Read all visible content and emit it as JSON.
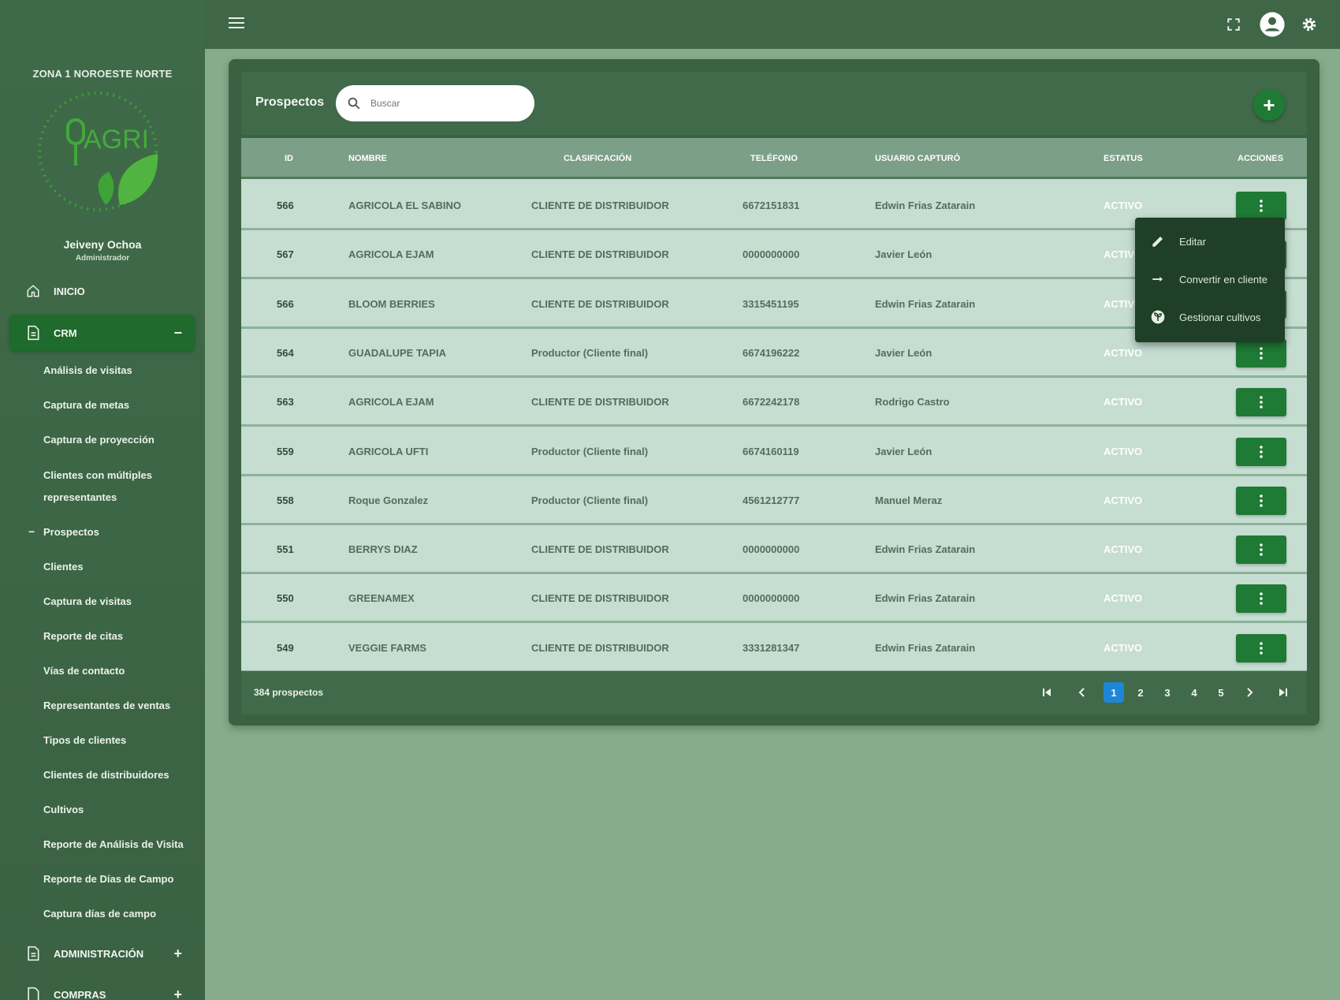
{
  "sidebar": {
    "zone_title": "ZONA 1 NOROESTE NORTE",
    "logo_text": "AGRI",
    "user_name": "Jeiveny Ochoa",
    "user_role": "Administrador",
    "menu": {
      "inicio": "INICIO",
      "crm": "CRM",
      "crm_sign": "−",
      "administracion": "ADMINISTRACIÓN",
      "administracion_sign": "+",
      "compras": "COMPRAS",
      "compras_sign": "+"
    },
    "crm_items": [
      "Análisis de visitas",
      "Captura de metas",
      "Captura de proyección",
      "Clientes con múltiples",
      "representantes",
      "Prospectos",
      "Clientes",
      "Captura de visitas",
      "Reporte de citas",
      "Vías de contacto",
      "Representantes de ventas",
      "Tipos de clientes",
      "Clientes de distribuidores",
      "Cultivos",
      "Reporte de Análisis de Visita",
      "Reporte de Días de Campo",
      "Captura días de campo"
    ],
    "prospectos_dash": "−"
  },
  "card": {
    "title": "Prospectos",
    "search_placeholder": "Buscar",
    "add_label": "+"
  },
  "table": {
    "headers": [
      "ID",
      "NOMBRE",
      "CLASIFICACIÓN",
      "TELÉFONO",
      "USUARIO CAPTURÓ",
      "ESTATUS",
      "ACCIONES"
    ],
    "rows": [
      {
        "id": "566",
        "nombre": "AGRICOLA EL SABINO",
        "clasificacion": "CLIENTE DE DISTRIBUIDOR",
        "telefono": "6672151831",
        "usuario": "Edwin Frias Zatarain",
        "estatus": "ACTIVO"
      },
      {
        "id": "567",
        "nombre": "AGRICOLA EJAM",
        "clasificacion": "CLIENTE DE DISTRIBUIDOR",
        "telefono": "0000000000",
        "usuario": "Javier León",
        "estatus": "ACTIVO"
      },
      {
        "id": "566",
        "nombre": "BLOOM BERRIES",
        "clasificacion": "CLIENTE DE DISTRIBUIDOR",
        "telefono": "3315451195",
        "usuario": "Edwin Frias Zatarain",
        "estatus": "ACTIVO"
      },
      {
        "id": "564",
        "nombre": "GUADALUPE TAPIA",
        "clasificacion": "Productor (Cliente final)",
        "telefono": "6674196222",
        "usuario": "Javier León",
        "estatus": "ACTIVO"
      },
      {
        "id": "563",
        "nombre": "AGRICOLA EJAM",
        "clasificacion": "CLIENTE DE DISTRIBUIDOR",
        "telefono": "6672242178",
        "usuario": "Rodrigo Castro",
        "estatus": "ACTIVO"
      },
      {
        "id": "559",
        "nombre": "AGRICOLA UFTI",
        "clasificacion": "Productor (Cliente final)",
        "telefono": "6674160119",
        "usuario": "Javier León",
        "estatus": "ACTIVO"
      },
      {
        "id": "558",
        "nombre": "Roque Gonzalez",
        "clasificacion": "Productor (Cliente final)",
        "telefono": "4561212777",
        "usuario": "Manuel Meraz",
        "estatus": "ACTIVO"
      },
      {
        "id": "551",
        "nombre": "BERRYS DIAZ",
        "clasificacion": "CLIENTE DE DISTRIBUIDOR",
        "telefono": "0000000000",
        "usuario": "Edwin Frias Zatarain",
        "estatus": "ACTIVO"
      },
      {
        "id": "550",
        "nombre": "GREENAMEX",
        "clasificacion": "CLIENTE DE DISTRIBUIDOR",
        "telefono": "0000000000",
        "usuario": "Edwin Frias Zatarain",
        "estatus": "ACTIVO"
      },
      {
        "id": "549",
        "nombre": "VEGGIE FARMS",
        "clasificacion": "CLIENTE DE DISTRIBUIDOR",
        "telefono": "3331281347",
        "usuario": "Edwin Frias Zatarain",
        "estatus": "ACTIVO"
      }
    ]
  },
  "dropdown": {
    "items": [
      "Editar",
      "Convertir en cliente",
      "Gestionar cultivos"
    ]
  },
  "footer": {
    "total": "384 prospectos",
    "pages": [
      "1",
      "2",
      "3",
      "4",
      "5"
    ],
    "current_page": "1"
  },
  "colors": {
    "accent_green": "#1e7a34",
    "current_page_blue": "#1d86d8"
  },
  "icons": {
    "menu": "hamburger-icon",
    "fullscreen": "fullscreen-icon",
    "account": "account-circle-icon",
    "settings": "gear-icon"
  }
}
